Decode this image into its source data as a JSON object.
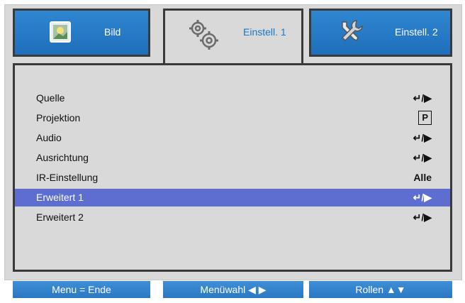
{
  "tabs": [
    {
      "label": "Bild",
      "icon": "picture-icon"
    },
    {
      "label": "Einstell. 1",
      "icon": "gears-icon"
    },
    {
      "label": "Einstell. 2",
      "icon": "tools-icon"
    }
  ],
  "menu": {
    "items": [
      {
        "label": "Quelle",
        "value": "↵/▶"
      },
      {
        "label": "Projektion",
        "value": "P"
      },
      {
        "label": "Audio",
        "value": "↵/▶"
      },
      {
        "label": "Ausrichtung",
        "value": "↵/▶"
      },
      {
        "label": "IR-Einstellung",
        "value": "Alle"
      },
      {
        "label": "Erweitert 1",
        "value": "↵/▶"
      },
      {
        "label": "Erweitert 2",
        "value": "↵/▶"
      }
    ]
  },
  "footer": {
    "exit": "Menu = Ende",
    "select": "Menüwahl ◀ ▶",
    "scroll": "Rollen ▲▼"
  },
  "colors": {
    "tab_blue": "#1f6fbb",
    "selected_row": "#5d6dd0",
    "background": "#d9d9d9"
  }
}
